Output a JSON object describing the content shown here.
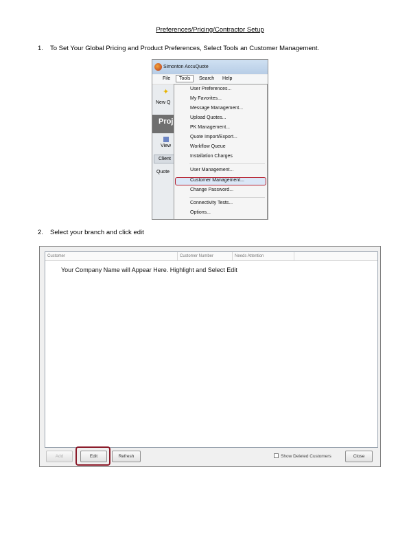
{
  "document": {
    "title": "Preferences/Pricing/Contractor Setup",
    "step1": {
      "num": "1.",
      "text": "To Set Your Global Pricing and Product Preferences, Select Tools an Customer Management."
    },
    "step2": {
      "num": "2.",
      "text": "Select your branch and click edit"
    }
  },
  "screenshot1": {
    "window_title": "Simonton AccuQuote",
    "menubar": {
      "file": "File",
      "tools": "Tools",
      "search": "Search",
      "help": "Help"
    },
    "side": {
      "new": "New Q",
      "projects": "Proj",
      "view": "View",
      "client": "Client",
      "quote": "Quote"
    },
    "tools_menu": [
      "User Preferences...",
      "My Favorites...",
      "Message Management...",
      "Upload Quotes...",
      "PK Management...",
      "Quote Import/Export...",
      "Workflow Queue",
      "Installation Charges",
      "User Management...",
      "Customer Management...",
      "Change Password...",
      "Connectivity Tests...",
      "Options..."
    ],
    "highlighted_item": "Customer Management...",
    "highlight_color": "#b51f2e"
  },
  "screenshot2": {
    "columns": [
      "Customer",
      "Customer Number",
      "Needs Attention"
    ],
    "company_note": "Your Company Name will Appear Here.  Highlight and Select Edit",
    "buttons": {
      "add": "Add",
      "edit": "Edit",
      "refresh": "Refresh",
      "close": "Close"
    },
    "show_deleted_label": "Show Deleted Customers",
    "show_deleted_checked": false,
    "edit_highlight_color": "#8b1b2a"
  }
}
